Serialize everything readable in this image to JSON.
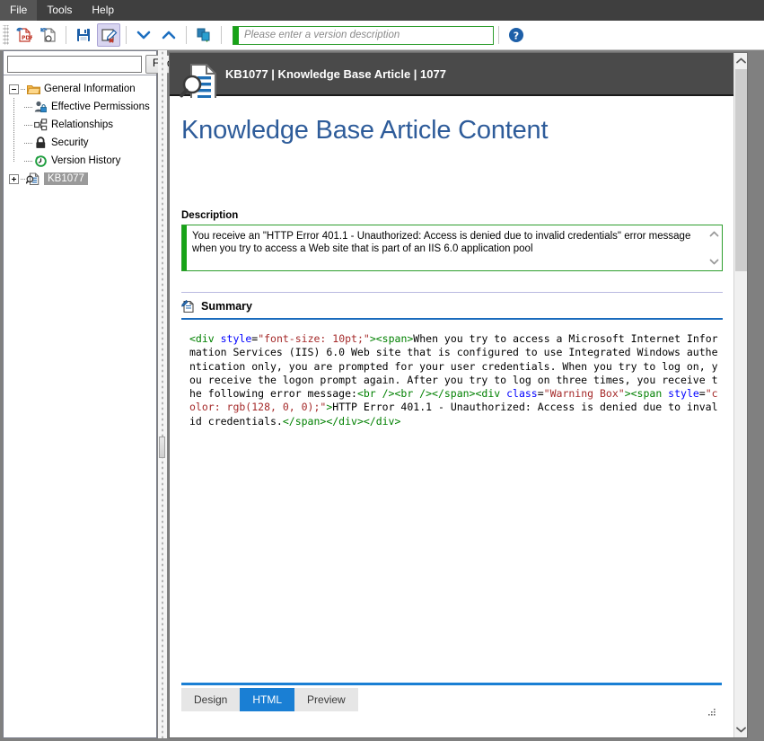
{
  "menu": {
    "items": [
      {
        "label": "File",
        "name": "menu-file"
      },
      {
        "label": "Tools",
        "name": "menu-tools"
      },
      {
        "label": "Help",
        "name": "menu-help"
      }
    ]
  },
  "toolbar": {
    "buttons": [
      {
        "name": "export-pdf-button",
        "icon": "pdf-export-icon",
        "title": "Export to PDF"
      },
      {
        "name": "refresh-document-button",
        "icon": "document-refresh-icon",
        "title": "Refresh"
      },
      {
        "name": "save-button",
        "icon": "floppy-save-icon",
        "title": "Save"
      },
      {
        "name": "edit-cancel-button",
        "icon": "edit-cancel-icon",
        "title": "Cancel Edit",
        "active": true
      },
      {
        "name": "next-item-button",
        "icon": "chevron-down-icon",
        "title": "Next"
      },
      {
        "name": "previous-item-button",
        "icon": "chevron-up-icon",
        "title": "Previous"
      },
      {
        "name": "copy-move-button",
        "icon": "copy-move-icon",
        "title": "Copy / Move"
      }
    ],
    "version_input": {
      "placeholder": "Please enter a version description",
      "value": ""
    },
    "help_icon": "help-question-icon"
  },
  "sidebar": {
    "find": {
      "input_value": "",
      "input_placeholder": "",
      "button_label": "Find"
    },
    "tree": [
      {
        "label": "General Information",
        "icon": "folder-open-icon",
        "expander": "minus",
        "level": 0,
        "selected": false
      },
      {
        "label": "Effective Permissions",
        "icon": "user-lock-icon",
        "level": 1,
        "selected": false
      },
      {
        "label": "Relationships",
        "icon": "relationships-icon",
        "level": 1,
        "selected": false
      },
      {
        "label": "Security",
        "icon": "padlock-icon",
        "level": 1,
        "selected": false
      },
      {
        "label": "Version History",
        "icon": "clock-history-icon",
        "level": 1,
        "selected": false
      },
      {
        "label": "KB1077",
        "icon": "document-search-icon",
        "expander": "plus",
        "level": 0,
        "selected": true
      }
    ]
  },
  "document": {
    "header_title": "KB1077 | Knowledge Base Article | 1077",
    "header_icon": "document-search-icon",
    "page_title": "Knowledge Base Article Content",
    "description": {
      "label": "Description",
      "value": "You receive an \"HTTP Error 401.1 - Unauthorized: Access is denied due to invalid credentials\" error message when you try to access a Web site that is part of an IIS 6.0 application pool"
    },
    "summary": {
      "label": "Summary",
      "icon": "edit-page-icon",
      "code_segments": [
        {
          "text": "<div ",
          "style": "tag"
        },
        {
          "text": "style",
          "style": "attr"
        },
        {
          "text": "=",
          "style": "plain"
        },
        {
          "text": "\"font-size: 10pt;\"",
          "style": "val"
        },
        {
          "text": ">",
          "style": "tag"
        },
        {
          "text": "<span>",
          "style": "tag"
        },
        {
          "text": "When you try to access a Microsoft Internet Information Services (IIS) 6.0 Web site that is configured to use Integrated Windows authentication only, you are prompted for your user credentials. When you try to log on, you receive the logon prompt again. After you try to log on three times, you receive the following error message:",
          "style": "plain"
        },
        {
          "text": "<br /><br /></span><div ",
          "style": "tag"
        },
        {
          "text": "class",
          "style": "attr"
        },
        {
          "text": "=",
          "style": "plain"
        },
        {
          "text": "\"Warning Box\"",
          "style": "val"
        },
        {
          "text": ">",
          "style": "tag"
        },
        {
          "text": "<span ",
          "style": "tag"
        },
        {
          "text": "style",
          "style": "attr"
        },
        {
          "text": "=",
          "style": "plain"
        },
        {
          "text": "\"color: rgb(128, 0, 0);\"",
          "style": "val"
        },
        {
          "text": ">",
          "style": "tag"
        },
        {
          "text": "HTTP Error 401.1 - Unauthorized: Access is denied due to invalid credentials.",
          "style": "plain"
        },
        {
          "text": "</span></div></div>",
          "style": "tag"
        }
      ]
    },
    "tabs": [
      {
        "label": "Design",
        "name": "tab-design",
        "active": false
      },
      {
        "label": "HTML",
        "name": "tab-html",
        "active": true
      },
      {
        "label": "Preview",
        "name": "tab-preview",
        "active": false
      }
    ]
  },
  "colors": {
    "menubar_bg": "#3f3f3f",
    "header_bg": "#4a4a4a",
    "accent_blue": "#1a7fd4",
    "title_blue": "#2e5c9a",
    "validation_green": "#17a317",
    "tag_green": "#008000",
    "attr_blue": "#0000ff",
    "value_brown": "#a52a2a",
    "selection_gray": "#9a9a9a",
    "window_bg": "#808080"
  }
}
